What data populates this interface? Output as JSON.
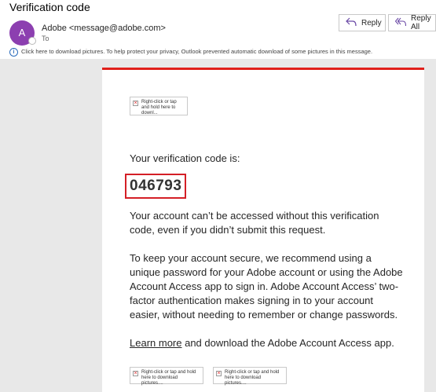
{
  "email": {
    "subject": "Verification code",
    "sender": {
      "avatar_letter": "A",
      "display": "Adobe <message@adobe.com>",
      "to_label": "To"
    },
    "actions": {
      "reply": "Reply",
      "reply_all": "Reply All"
    },
    "info_bar": "Click here to download pictures. To help protect your privacy, Outlook prevented automatic download of some pictures in this message."
  },
  "body": {
    "image_placeholder_top": "Right-click or tap and hold here to downl...",
    "intro": "Your verification code is:",
    "code": "046793",
    "paragraph1": "Your account can’t be accessed without this verification code, even if you didn’t submit this request.",
    "paragraph2": "To keep your account secure, we recommend using a unique password for your Adobe account or using the Adobe Account Access app to sign in. Adobe Account Access’ two-factor authentication makes signing in to your account easier, without needing to remember or change passwords.",
    "learn_more": "Learn more",
    "paragraph3_rest": " and download the Adobe Account Access app.",
    "image_placeholder_bottom_1": "Right-click or tap and hold here to download pictures....",
    "image_placeholder_bottom_2": "Right-click or tap and hold here to download pictures...."
  },
  "colors": {
    "avatar": "#8c3fb0",
    "brand_bar": "#e0201b",
    "code_highlight": "#d41f26",
    "info_icon": "#2b6cbc"
  },
  "icons": [
    "reply-icon",
    "reply-all-icon",
    "info-icon",
    "broken-image-icon"
  ]
}
